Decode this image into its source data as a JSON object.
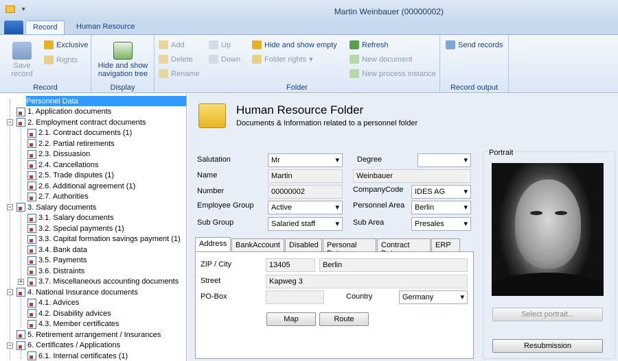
{
  "window": {
    "title": "Martin Weinbauer (00000002)"
  },
  "tabs": [
    "Record",
    "Human Resource"
  ],
  "ribbon": {
    "record": {
      "save": "Save record",
      "exclusive": "Exclusive",
      "rights": "Rights",
      "label": "Record"
    },
    "display": {
      "hide_show": "Hide and show navigation tree",
      "label": "Display"
    },
    "folder": {
      "add": "Add",
      "delete": "Delete",
      "rename": "Rename",
      "up": "Up",
      "down": "Down",
      "hide_empty": "Hide and show empty",
      "folder_rights": "Folder rights",
      "refresh": "Refresh",
      "new_document": "New document",
      "new_process": "New process instance",
      "label": "Folder"
    },
    "output": {
      "send": "Send records",
      "label": "Record output"
    }
  },
  "tree": [
    {
      "text": "Personnel Data",
      "level": 0,
      "selected": true
    },
    {
      "text": "1. Application documents",
      "level": 1
    },
    {
      "text": "2. Employment contract documents",
      "level": 1,
      "expander": "-"
    },
    {
      "text": "2.1. Contract documents (1)",
      "level": 2
    },
    {
      "text": "2.2. Partial retirements",
      "level": 2
    },
    {
      "text": "2.3. Dissuasion",
      "level": 2
    },
    {
      "text": "2.4. Cancellations",
      "level": 2
    },
    {
      "text": "2.5. Trade disputes (1)",
      "level": 2
    },
    {
      "text": "2.6. Additional agreement (1)",
      "level": 2
    },
    {
      "text": "2.7. Authorities",
      "level": 2
    },
    {
      "text": "3. Salary documents",
      "level": 1,
      "expander": "-"
    },
    {
      "text": "3.1. Salary documents",
      "level": 2
    },
    {
      "text": "3.2. Special payments (1)",
      "level": 2
    },
    {
      "text": "3.3. Capital formation savings payment (1)",
      "level": 2
    },
    {
      "text": "3.4. Bank data",
      "level": 2
    },
    {
      "text": "3.5. Payments",
      "level": 2
    },
    {
      "text": "3.6. Distraints",
      "level": 2
    },
    {
      "text": "3.7. Miscellaneous accounting documents",
      "level": 2,
      "expander": "+"
    },
    {
      "text": "4. National Insurance documents",
      "level": 1,
      "expander": "-"
    },
    {
      "text": "4.1. Advices",
      "level": 2
    },
    {
      "text": "4.2. Disability advices",
      "level": 2
    },
    {
      "text": "4.3. Member certificates",
      "level": 2
    },
    {
      "text": "5. Retirement arrangement / Insurances",
      "level": 1
    },
    {
      "text": "6. Certificates / Applications",
      "level": 1,
      "expander": "-"
    },
    {
      "text": "6.1. Internal certificates (1)",
      "level": 2
    }
  ],
  "header": {
    "title": "Human Resource Folder",
    "subtitle": "Documents & Information related to a personnel folder"
  },
  "form": {
    "salutation_label": "Salutation",
    "salutation": "Mr",
    "degree_label": "Degree",
    "degree": "",
    "name_label": "Name",
    "first_name": "Martin",
    "last_name": "Weinbauer",
    "number_label": "Number",
    "number": "00000002",
    "company_label": "CompanyCode",
    "company": "IDES AG",
    "group_label": "Employee Group",
    "group": "Active",
    "area_label": "Personnel Area",
    "area": "Berlin",
    "subgroup_label": "Sub Group",
    "subgroup": "Salaried staff",
    "subarea_label": "Sub Area",
    "subarea": "Presales"
  },
  "detail_tabs": [
    "Address",
    "BankAccount",
    "Disabled",
    "Personal Data",
    "Contract Data",
    "ERP"
  ],
  "address": {
    "zip_label": "ZIP / City",
    "zip": "13405",
    "city": "Berlin",
    "street_label": "Street",
    "street": "Kapweg 3",
    "pobox_label": "PO-Box",
    "pobox": "",
    "country_label": "Country",
    "country": "Germany",
    "map": "Map",
    "route": "Route"
  },
  "portrait": {
    "label": "Portrait",
    "select": "Select portrait...",
    "resubmission": "Resubmission"
  }
}
